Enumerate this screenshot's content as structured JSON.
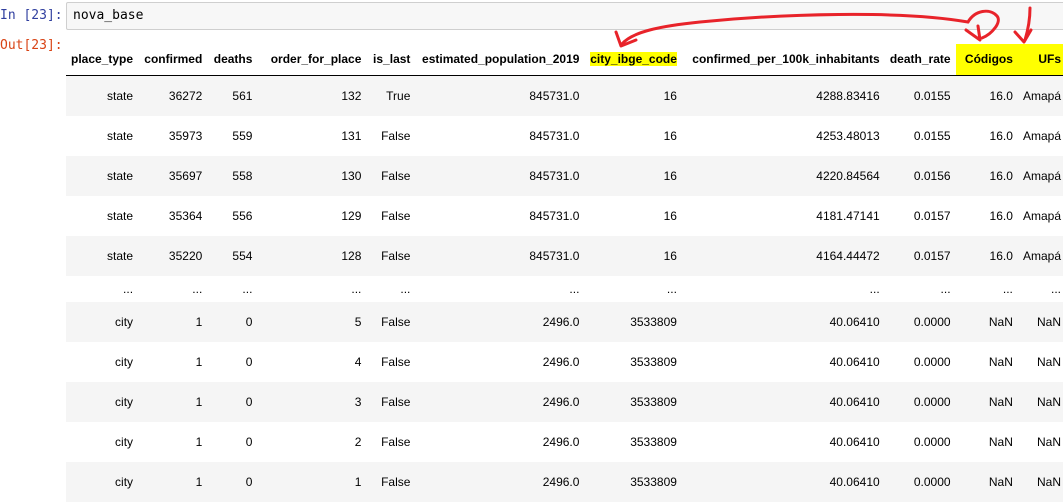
{
  "cell": {
    "in_prompt": "In [23]:",
    "out_prompt": "Out[23]:",
    "code": "nova_base"
  },
  "table": {
    "columns": [
      "place_type",
      "confirmed",
      "deaths",
      "order_for_place",
      "is_last",
      "estimated_population_2019",
      "city_ibge_code",
      "confirmed_per_100k_inhabitants",
      "death_rate",
      "Códigos",
      "UFs"
    ],
    "highlighted_columns": [
      "city_ibge_code",
      "Códigos",
      "UFs"
    ],
    "rows": [
      [
        "state",
        "36272",
        "561",
        "132",
        "True",
        "845731.0",
        "16",
        "4288.83416",
        "0.0155",
        "16.0",
        "Amapá"
      ],
      [
        "state",
        "35973",
        "559",
        "131",
        "False",
        "845731.0",
        "16",
        "4253.48013",
        "0.0155",
        "16.0",
        "Amapá"
      ],
      [
        "state",
        "35697",
        "558",
        "130",
        "False",
        "845731.0",
        "16",
        "4220.84564",
        "0.0156",
        "16.0",
        "Amapá"
      ],
      [
        "state",
        "35364",
        "556",
        "129",
        "False",
        "845731.0",
        "16",
        "4181.47141",
        "0.0157",
        "16.0",
        "Amapá"
      ],
      [
        "state",
        "35220",
        "554",
        "128",
        "False",
        "845731.0",
        "16",
        "4164.44472",
        "0.0157",
        "16.0",
        "Amapá"
      ],
      [
        "...",
        "...",
        "...",
        "...",
        "...",
        "...",
        "...",
        "...",
        "...",
        "...",
        "..."
      ],
      [
        "city",
        "1",
        "0",
        "5",
        "False",
        "2496.0",
        "3533809",
        "40.06410",
        "0.0000",
        "NaN",
        "NaN"
      ],
      [
        "city",
        "1",
        "0",
        "4",
        "False",
        "2496.0",
        "3533809",
        "40.06410",
        "0.0000",
        "NaN",
        "NaN"
      ],
      [
        "city",
        "1",
        "0",
        "3",
        "False",
        "2496.0",
        "3533809",
        "40.06410",
        "0.0000",
        "NaN",
        "NaN"
      ],
      [
        "city",
        "1",
        "0",
        "2",
        "False",
        "2496.0",
        "3533809",
        "40.06410",
        "0.0000",
        "NaN",
        "NaN"
      ],
      [
        "city",
        "1",
        "0",
        "1",
        "False",
        "2496.0",
        "3533809",
        "40.06410",
        "0.0000",
        "NaN",
        "NaN"
      ]
    ]
  },
  "annotation": {
    "color": "#e8232a"
  },
  "colors": {
    "highlight": "#ffff00",
    "in_prompt": "#303f9f",
    "out_prompt": "#d84315"
  }
}
